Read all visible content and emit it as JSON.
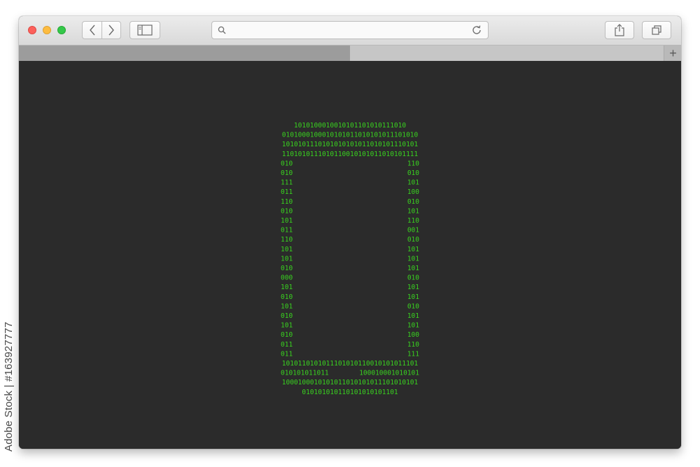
{
  "window": {
    "buttons": {
      "close_color": "#fc605b",
      "minimize_color": "#fdbc40",
      "zoom_color": "#34c84a"
    },
    "toolbar": {
      "back_icon": "chevron-left-icon",
      "forward_icon": "chevron-right-icon",
      "sidebar_icon": "sidebar-icon",
      "share_icon": "share-icon",
      "tabs_icon": "tab-overview-icon"
    },
    "address_bar": {
      "value": "",
      "search_icon": "magnifier-icon",
      "reload_icon": "reload-icon"
    },
    "tab_bar": {
      "add_tab_label": "+"
    }
  },
  "content": {
    "background": "#2b2b2b",
    "graphic": {
      "description_icon": "smartphone-icon",
      "color": "#39d21f",
      "rows": [
        "1010100010010101101010111010",
        "0101000100010101011010101011101010",
        "1010101110101010101011010101110101",
        "1101010111010110010101011010101111",
        "010                          110",
        "010                          010",
        "111                          101",
        "011                          100",
        "110                          010",
        "010                          101",
        "101                          110",
        "011                          001",
        "110                          010",
        "101                          101",
        "101                          101",
        "010                          101",
        "000                          010",
        "101                          101",
        "010                          101",
        "101                          010",
        "010                          101",
        "101                          101",
        "010                          100",
        "011                          110",
        "011                          111",
        "1010110101011101010110010101011101",
        "010101011011        100010001010101",
        "1000100010101011010101011101010101",
        "010101010110101010101101"
      ]
    }
  },
  "watermarks": {
    "brand": "Adobe Stock",
    "side_id": "Adobe Stock | #163927777"
  }
}
